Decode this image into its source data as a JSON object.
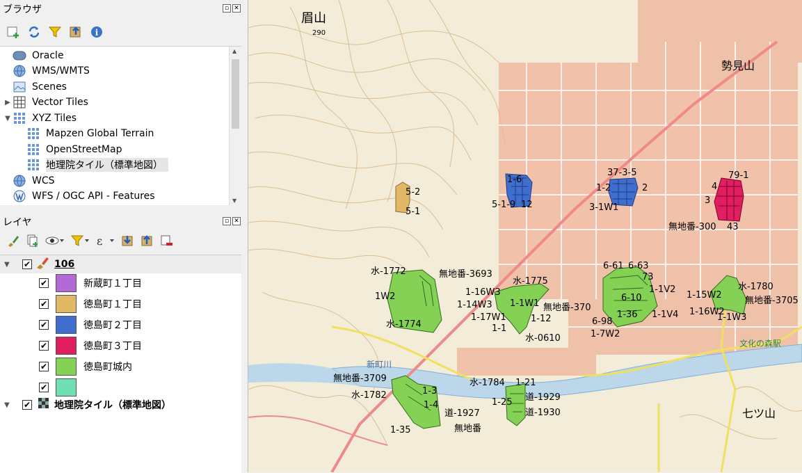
{
  "browser_panel": {
    "title": "ブラウザ",
    "items": [
      {
        "label": "Oracle",
        "icon": "oracle-icon"
      },
      {
        "label": "WMS/WMTS",
        "icon": "globe-icon"
      },
      {
        "label": "Scenes",
        "icon": "scenes-icon"
      },
      {
        "label": "Vector Tiles",
        "icon": "grid-icon"
      },
      {
        "label": "XYZ Tiles",
        "icon": "grid-icon"
      },
      {
        "label": "Mapzen Global Terrain",
        "icon": "grid-icon"
      },
      {
        "label": "OpenStreetMap",
        "icon": "grid-icon"
      },
      {
        "label": "地理院タイル（標準地図）",
        "icon": "grid-icon"
      },
      {
        "label": "WCS",
        "icon": "globe-icon"
      },
      {
        "label": "WFS / OGC API - Features",
        "icon": "wfs-icon"
      }
    ]
  },
  "layers_panel": {
    "title": "レイヤ",
    "group_name": "106",
    "layers": [
      {
        "label": "新蔵町１丁目",
        "color": "#b46ad6"
      },
      {
        "label": "徳島町１丁目",
        "color": "#e2b866"
      },
      {
        "label": "徳島町２丁目",
        "color": "#3f6ecf"
      },
      {
        "label": "徳島町３丁目",
        "color": "#e01e60"
      },
      {
        "label": "徳島町城内",
        "color": "#85d156"
      },
      {
        "label": "",
        "color": "#6ee0b4"
      }
    ],
    "basemap_label": "地理院タイル（標準地図）"
  },
  "map": {
    "labels": {
      "mayuyama": "眉山",
      "mayuyama_elev": "290",
      "seimizan": "勢見山",
      "shinkawa": "新町川",
      "shichizan": "七ツ山",
      "bunka": "文化の森駅",
      "mm3693": "無地番-3693",
      "mm300": "無地番-300",
      "mm370": "無地番-370",
      "mm3705": "無地番-3705",
      "mm3709": "無地番-3709",
      "mm_bottom": "無地番",
      "w1772": "水-1772",
      "w1774": "水-1774",
      "w1775": "水-1775",
      "w1780": "水-1780",
      "w1782": "水-1782",
      "w1784": "水-1784",
      "w0610": "水-0610",
      "r1927": "道-1927",
      "r1929": "道-1929",
      "r1930": "道-1930",
      "p1_16w3": "1-16W3",
      "p1_14w3": "1-14W3",
      "p1_17w1": "1-17W1",
      "p1_1w1": "1-1W1",
      "p1_12": "1-12",
      "p1_15w2": "1-15W2",
      "p1_16w2": "1-16W2",
      "p1_1w3": "1-1W3",
      "p1_1w4": "1-1V4",
      "p1_1v2": "1-1V2",
      "p6_61": "6-61",
      "p6_63": "6-63",
      "p6_10": "6-10",
      "p6_98": "6-98",
      "p1_7w2": "1-7W2",
      "p1_36": "1-36",
      "p73": "73",
      "p5_2": "5-2",
      "p5_1": "5-1",
      "p5_1_9": "5-1-9",
      "p12": "12",
      "p37_3_5": "37-3-5",
      "p3_1w1": "3-1W1",
      "p1_2": "1-2",
      "p2": "2",
      "p79_1": "79-1",
      "p4": "4",
      "p3": "3",
      "p43": "43",
      "p1_3": "1-3",
      "p1_4": "1-4",
      "p1_35": "1-35",
      "p1_21": "1-21",
      "p1_25": "1-25",
      "p1_w2": "1W2",
      "p1_6": "1-6",
      "p1_1": "1-1"
    }
  }
}
